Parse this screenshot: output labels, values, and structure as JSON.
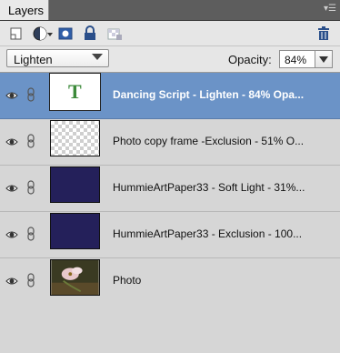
{
  "panel": {
    "tab_label": "Layers",
    "menu_icon": "panel-menu-icon"
  },
  "toolbar": {
    "tools": [
      "new-layer-icon",
      "adjustment-layer-icon",
      "layer-mask-icon",
      "lock-all-icon",
      "lock-transparency-icon",
      "trash-icon"
    ]
  },
  "options": {
    "blend_mode": "Lighten",
    "opacity_label": "Opacity:",
    "opacity_value": "84%"
  },
  "layers": [
    {
      "name": "Dancing Script - Lighten - 84% Opa...",
      "selected": true,
      "thumb": "text",
      "thumb_letter": "T"
    },
    {
      "name": "Photo copy frame -Exclusion - 51% O...",
      "selected": false,
      "thumb": "transparent"
    },
    {
      "name": "HummieArtPaper33 - Soft Light - 31%...",
      "selected": false,
      "thumb": "paper"
    },
    {
      "name": "HummieArtPaper33 - Exclusion - 100...",
      "selected": false,
      "thumb": "paper"
    },
    {
      "name": "Photo",
      "selected": false,
      "thumb": "photo"
    }
  ],
  "colors": {
    "selection": "#6b93c7",
    "paper": "#24205a",
    "text_thumb_letter": "#3c8a3a"
  }
}
